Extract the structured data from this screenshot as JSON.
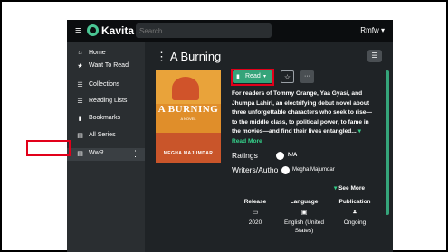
{
  "app": {
    "brand": "Kavita",
    "search_placeholder": "Search...",
    "user": "Rmfw"
  },
  "sidebar": {
    "items": [
      {
        "icon": "home-icon",
        "glyph": "⌂",
        "label": "Home"
      },
      {
        "icon": "star-icon",
        "glyph": "★",
        "label": "Want To Read"
      },
      {
        "icon": "list-icon",
        "glyph": "☰",
        "label": "Collections"
      },
      {
        "icon": "list-numbered-icon",
        "glyph": "☰",
        "label": "Reading Lists"
      },
      {
        "icon": "bookmark-icon",
        "glyph": "▮",
        "label": "Bookmarks"
      },
      {
        "icon": "grid-icon",
        "glyph": "▤",
        "label": "All Series"
      },
      {
        "icon": "library-icon",
        "glyph": "▤",
        "label": "WwR"
      }
    ]
  },
  "series": {
    "title": "A Burning",
    "cover_title": "A BURNING",
    "cover_sub": "A NOVEL",
    "cover_author": "MEGHA MAJUMDAR",
    "read_label": "Read",
    "summary": "For readers of Tommy Orange, Yaa Gyasi, and Jhumpa Lahiri, an electrifying debut novel about three unforgettable characters who seek to rise—to the middle class, to political power, to fame in the movies—and find their lives entangled...",
    "read_more": "Read More",
    "ratings_label": "Ratings",
    "ratings_value": "N/A",
    "writers_label": "Writers/Autho",
    "author": "Megha Majumdar",
    "see_more": "See More",
    "details": [
      {
        "label": "Release",
        "icon": "calendar-icon",
        "glyph": "▭",
        "value": "2020"
      },
      {
        "label": "Language",
        "icon": "language-icon",
        "glyph": "▣",
        "value": "English (United States)"
      },
      {
        "label": "Publication",
        "icon": "hourglass-icon",
        "glyph": "⧗",
        "value": "Ongoing"
      }
    ]
  }
}
